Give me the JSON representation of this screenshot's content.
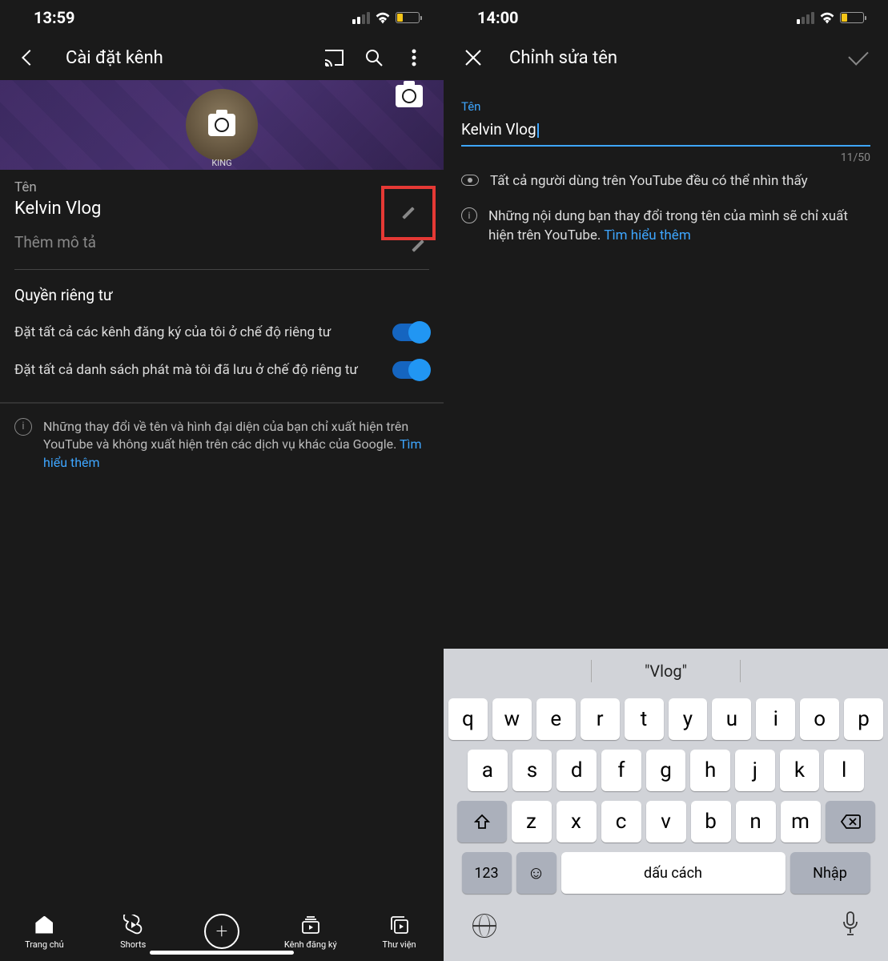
{
  "left": {
    "status": {
      "time": "13:59"
    },
    "header": {
      "title": "Cài đặt kênh"
    },
    "banner_caption": "KING",
    "name_label": "Tên",
    "name_value": "Kelvin Vlog",
    "desc_placeholder": "Thêm mô tả",
    "privacy_title": "Quyền riêng tư",
    "switch1": "Đặt tất cả các kênh đăng ký của tôi ở chế độ riêng tư",
    "switch2": "Đặt tất cả danh sách phát mà tôi đã lưu ở chế độ riêng tư",
    "info_text": "Những thay đổi về tên và hình đại diện của bạn chỉ xuất hiện trên YouTube và không xuất hiện trên các dịch vụ khác của Google. ",
    "info_link": "Tìm hiểu thêm",
    "nav": {
      "home": "Trang chủ",
      "shorts": "Shorts",
      "subs": "Kênh đăng ký",
      "library": "Thư viện"
    }
  },
  "right": {
    "status": {
      "time": "14:00"
    },
    "header": {
      "title": "Chỉnh sửa tên"
    },
    "field_label": "Tên",
    "field_value": "Kelvin Vlog",
    "counter": "11/50",
    "visibility": "Tất cả người dùng trên YouTube đều có thể nhìn thấy",
    "change_note": "Những nội dung bạn thay đổi trong tên của mình sẽ chỉ xuất hiện trên YouTube. ",
    "change_link": "Tìm hiểu thêm",
    "keyboard": {
      "suggestion": "\"Vlog\"",
      "row1": [
        "q",
        "w",
        "e",
        "r",
        "t",
        "y",
        "u",
        "i",
        "o",
        "p"
      ],
      "row2": [
        "a",
        "s",
        "d",
        "f",
        "g",
        "h",
        "j",
        "k",
        "l"
      ],
      "row3": [
        "z",
        "x",
        "c",
        "v",
        "b",
        "n",
        "m"
      ],
      "num_key": "123",
      "space": "dấu cách",
      "enter": "Nhập"
    }
  }
}
